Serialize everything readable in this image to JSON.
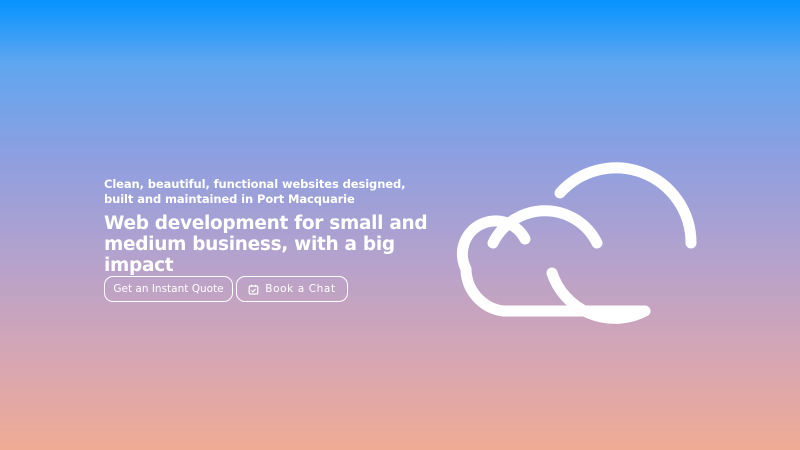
{
  "hero": {
    "tagline": "Clean, beautiful, functional websites designed, built and maintained in Port Macquarie",
    "headline": "Web development for small and medium business, with a big impact",
    "buttons": {
      "quote_label": "Get an Instant Quote",
      "chat_label": "Book a Chat",
      "chat_icon": "calendar-check-icon"
    },
    "illustration": "cloud-icon"
  },
  "colors": {
    "gradient_top": "#0593FF",
    "gradient_bottom": "#F0AB94",
    "foreground": "#FFFFFF"
  }
}
